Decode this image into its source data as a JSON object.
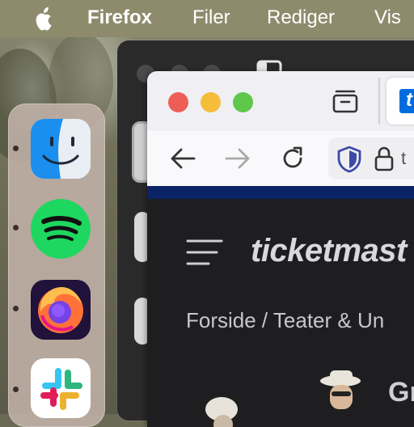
{
  "menubar": {
    "app_name": "Firefox",
    "menus": [
      "Filer",
      "Rediger",
      "Vis"
    ]
  },
  "dock": {
    "apps": [
      {
        "name": "finder-icon"
      },
      {
        "name": "spotify-icon"
      },
      {
        "name": "firefox-icon"
      },
      {
        "name": "slack-icon"
      }
    ]
  },
  "browser": {
    "toolbar": {
      "back": "back-icon",
      "forward": "forward-icon",
      "reload": "reload-icon",
      "shield": "shield-icon",
      "lock": "lock-icon",
      "url_fragment": "t"
    },
    "page": {
      "brand": "ticketmast",
      "breadcrumb": "Forside / Teater & Un",
      "heading_fragment": "Gr"
    }
  },
  "colors": {
    "menubar": "#8e8b6d",
    "site_background": "#1e1e20",
    "accent_blue": "#0a2466",
    "close": "#ee5e57",
    "minimize": "#f5bd3a",
    "zoom": "#5fc74a"
  }
}
